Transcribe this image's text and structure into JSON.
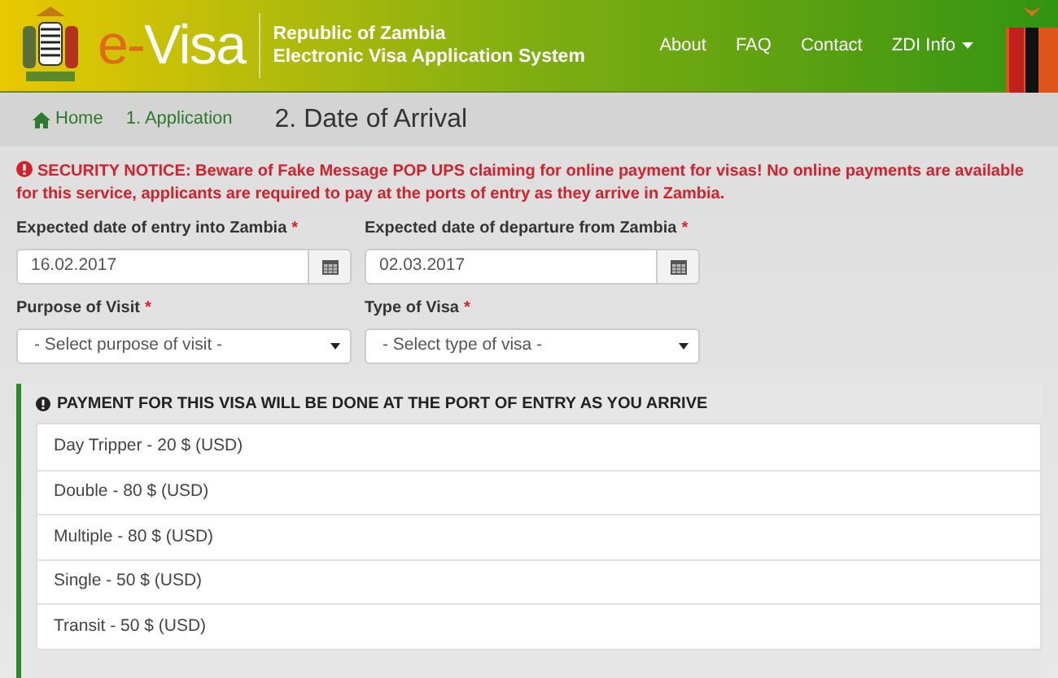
{
  "header": {
    "logo_prefix": "e-",
    "logo_main": "Visa",
    "title_lines": [
      "Republic of Zambia",
      "Electronic Visa Application System"
    ],
    "nav": [
      {
        "label": "About",
        "dropdown": false
      },
      {
        "label": "FAQ",
        "dropdown": false
      },
      {
        "label": "Contact",
        "dropdown": false
      },
      {
        "label": "ZDI Info",
        "dropdown": true
      }
    ]
  },
  "breadcrumb": {
    "items": [
      "Home",
      "1. Application"
    ],
    "current": "2. Date of Arrival"
  },
  "notice": "**SECURITY NOTICE: Beware of Fake Message POP UPS claiming for online payment for visas! No online payments are available for this service, applicants are required to pay at the ports of entry as they arrive in Zambia.**",
  "fields": [
    {
      "kind": "date",
      "label": "Expected date of entry into Zambia",
      "required_mark": "*",
      "value": "16.02.2017"
    },
    {
      "kind": "date",
      "label": "Expected date of departure from Zambia",
      "required_mark": "*",
      "value": "02.03.2017"
    },
    {
      "kind": "select",
      "label": "Purpose of Visit",
      "required_mark": "*",
      "value": "- Select purpose of visit -"
    },
    {
      "kind": "select",
      "label": "Type of Visa",
      "required_mark": "*",
      "value": "- Select type of visa -"
    }
  ],
  "payment_panel": {
    "heading": "PAYMENT FOR THIS VISA WILL BE DONE AT THE PORT OF ENTRY AS YOU ARRIVE",
    "options": [
      "Day Tripper - 20 $ (USD)",
      "Double - 80 $ (USD)",
      "Multiple - 80 $ (USD)",
      "Single - 50 $ (USD)",
      "Transit - 50 $ (USD)"
    ]
  }
}
